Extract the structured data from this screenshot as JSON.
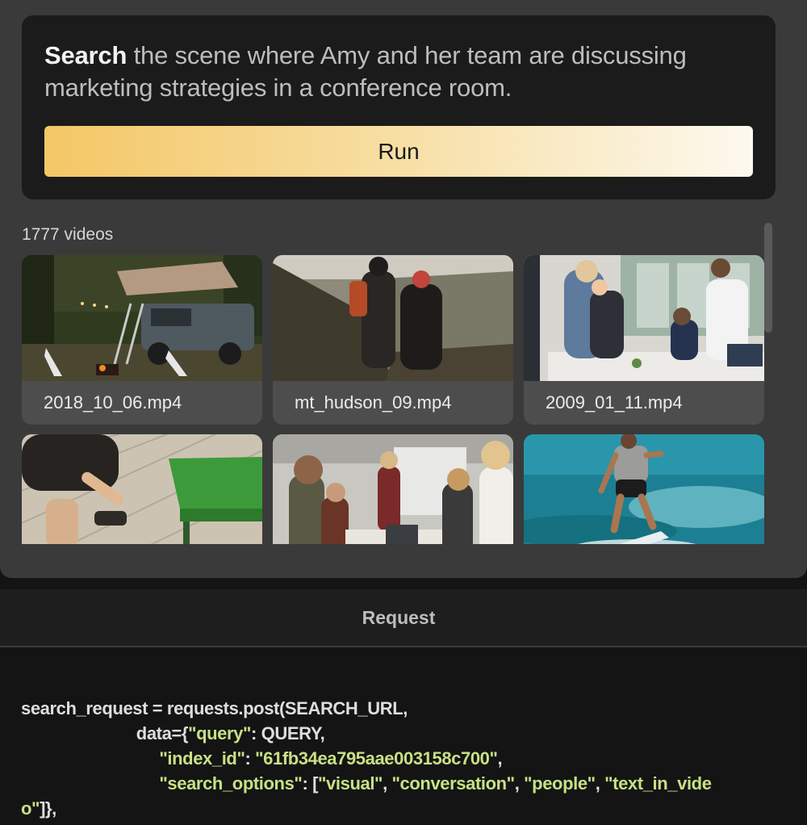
{
  "prompt": {
    "keyword": "Search",
    "text": " the scene where Amy and her team are discussing marketing strategies in a conference room."
  },
  "run_button": "Run",
  "gallery": {
    "count_label": "1777 videos",
    "videos": [
      {
        "filename": "2018_10_06.mp4"
      },
      {
        "filename": "mt_hudson_09.mp4"
      },
      {
        "filename": "2009_01_11.mp4"
      },
      {
        "filename": ""
      },
      {
        "filename": ""
      },
      {
        "filename": ""
      }
    ]
  },
  "request": {
    "title": "Request",
    "code": {
      "l1": "search_request = requests.post(SEARCH_URL,",
      "l2_pre": "                         data={",
      "l2_key": "\"query\"",
      "l2_post": ": QUERY,",
      "l3_pre": "                              ",
      "l3_key": "\"index_id\"",
      "l3_mid": ": ",
      "l3_val": "\"61fb34ea795aae003158c700\"",
      "l3_post": ",",
      "l4_pre": "                              ",
      "l4_key": "\"search_options\"",
      "l4_mid": ": [",
      "l4_v1": "\"visual\"",
      "l4_c1": ", ",
      "l4_v2": "\"conversation\"",
      "l4_c2": ", ",
      "l4_v3": "\"people\"",
      "l4_c3": ", ",
      "l4_v4a": "\"text_in_vide",
      "l5_v4b": "o\"",
      "l5_post": "]},"
    }
  },
  "colors": {
    "accent_gradient_start": "#f4c766",
    "accent_gradient_end": "#fdf9ef",
    "code_string": "#c7e184"
  }
}
